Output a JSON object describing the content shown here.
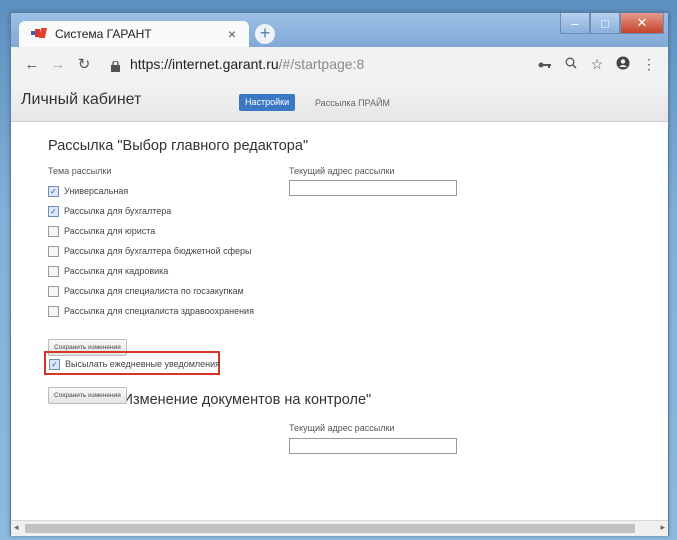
{
  "browser": {
    "tab_title": "Система ГАРАНТ",
    "tab_close": "×",
    "new_tab": "+",
    "url_host": "https://internet.garant.ru",
    "url_path": "/#/startpage:8",
    "window_min": "–",
    "window_max": "□",
    "window_close": "✕"
  },
  "app": {
    "title": "Личный кабинет",
    "nav": [
      {
        "label": "Настройки",
        "active": true
      },
      {
        "label": "Рассылка ПРАЙМ",
        "active": false
      }
    ]
  },
  "section1": {
    "title": "Рассылка \"Выбор главного редактора\"",
    "topic_label": "Тема рассылки",
    "address_label": "Текущий адрес рассылки",
    "address_value": "",
    "options": [
      {
        "label": "Универсальная",
        "checked": true
      },
      {
        "label": "Рассылка для бухгалтера",
        "checked": true
      },
      {
        "label": "Рассылка для юриста",
        "checked": false
      },
      {
        "label": "Рассылка для бухгалтера бюджетной сферы",
        "checked": false
      },
      {
        "label": "Рассылка для кадровика",
        "checked": false
      },
      {
        "label": "Рассылка для специалиста по госзакупкам",
        "checked": false
      },
      {
        "label": "Рассылка для специалиста здравоохранения",
        "checked": false
      }
    ],
    "save_label": "Сохранить изменения"
  },
  "section2": {
    "title": "Рассылка \"Изменение документов на контроле\"",
    "address_label": "Текущий адрес рассылки",
    "address_value": "",
    "daily_label": "Высылать ежедневные уведомления",
    "daily_checked": true,
    "save_label": "Сохранить изменения"
  },
  "colors": {
    "accent": "#3b78c4",
    "highlight": "#d9362a"
  }
}
